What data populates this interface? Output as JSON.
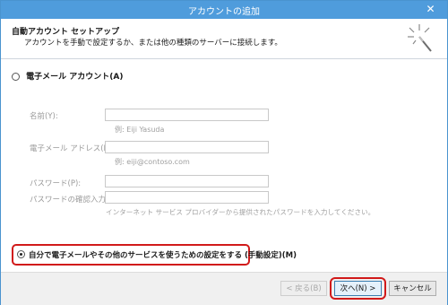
{
  "window": {
    "title": "アカウントの追加",
    "close_glyph": "✕"
  },
  "header": {
    "title": "自動アカウント セットアップ",
    "description": "アカウントを手動で設定するか、または他の種類のサーバーに接続します。",
    "icon": "magic-wand-icon"
  },
  "options": {
    "email_account": {
      "label": "電子メール アカウント(A)",
      "selected": false
    },
    "manual_setup": {
      "label": "自分で電子メールやその他のサービスを使うための設定をする (手動設定)(M)",
      "selected": true
    }
  },
  "form": {
    "name": {
      "label": "名前(Y):",
      "value": "",
      "hint": "例: Eiji Yasuda"
    },
    "email": {
      "label": "電子メール アドレス(E):",
      "value": "",
      "hint": "例: eiji@contoso.com"
    },
    "password": {
      "label": "パスワード(P):",
      "value": ""
    },
    "password_confirm": {
      "label": "パスワードの確認入力(T):",
      "value": ""
    },
    "password_hint": "インターネット サービス プロバイダーから提供されたパスワードを入力してください。"
  },
  "buttons": {
    "back": "< 戻る(B)",
    "next": "次へ(N) >",
    "cancel": "キャンセル"
  },
  "colors": {
    "titlebar": "#4f9cdc",
    "highlight": "#d11a1a"
  }
}
